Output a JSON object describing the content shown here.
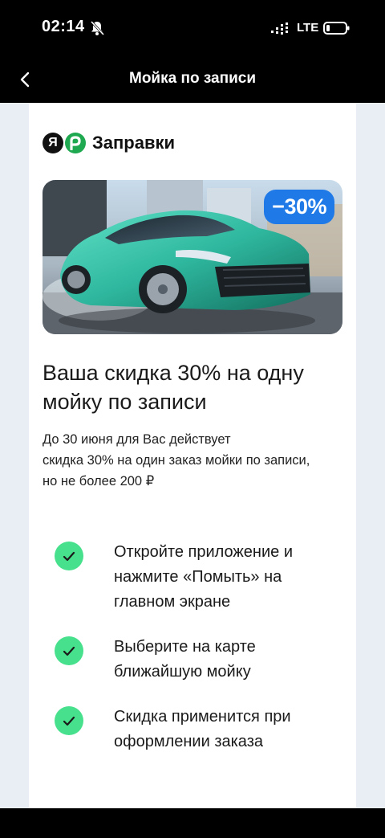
{
  "status_bar": {
    "time": "02:14",
    "network": "LTE",
    "icons": [
      "bell-off-icon",
      "signal-icon",
      "battery-icon"
    ]
  },
  "nav": {
    "title": "Мойка по записи",
    "back_icon": "chevron-left-icon"
  },
  "brand": {
    "ya_letter": "Я",
    "name": "Заправки",
    "colors": {
      "ya": "#111111",
      "r": "#1ea84f"
    }
  },
  "promo": {
    "badge": "−30%",
    "badge_color": "#1f7ae8",
    "image": "car-photo"
  },
  "headline": "Ваша скидка 30% на одну мойку по записи",
  "description": {
    "line1": "До 30 июня для Вас действует",
    "line2": "скидка 30% на один заказ мойки по записи,",
    "line3": "но не более 200 ₽"
  },
  "steps": [
    {
      "lines": [
        "Откройте приложение и",
        "нажмите «Помыть» на",
        "главном экране"
      ]
    },
    {
      "lines": [
        "Выберите на карте",
        "ближайшую мойку"
      ]
    },
    {
      "lines": [
        "Скидка применится при",
        "оформлении заказа"
      ]
    }
  ],
  "colors": {
    "check": "#47e08c",
    "page_bg": "#e9eef5"
  }
}
